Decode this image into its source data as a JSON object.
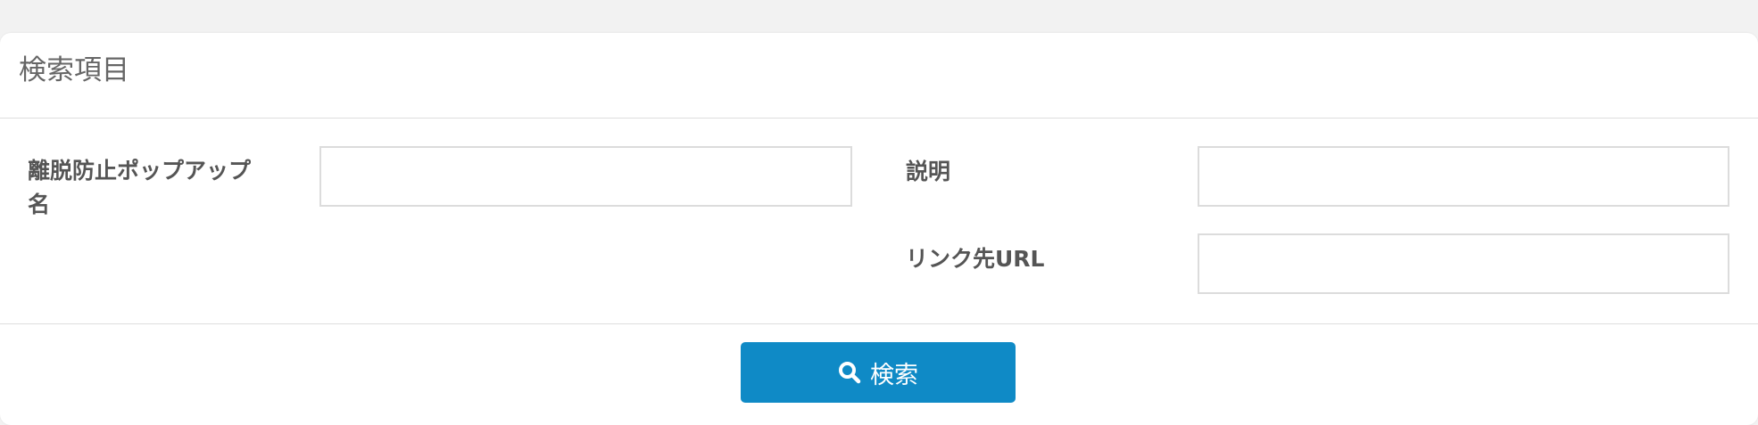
{
  "panel": {
    "title": "検索項目"
  },
  "fields": {
    "popup_name": {
      "label": "離脱防止ポップアップ名",
      "value": ""
    },
    "description": {
      "label": "説明",
      "value": ""
    },
    "link_url": {
      "label": "リンク先URL",
      "value": ""
    }
  },
  "actions": {
    "search_label": "検索",
    "search_icon": "search-icon"
  },
  "colors": {
    "primary_button": "#0f8ac6",
    "page_background": "#f2f2f2",
    "label_text": "#555555"
  }
}
